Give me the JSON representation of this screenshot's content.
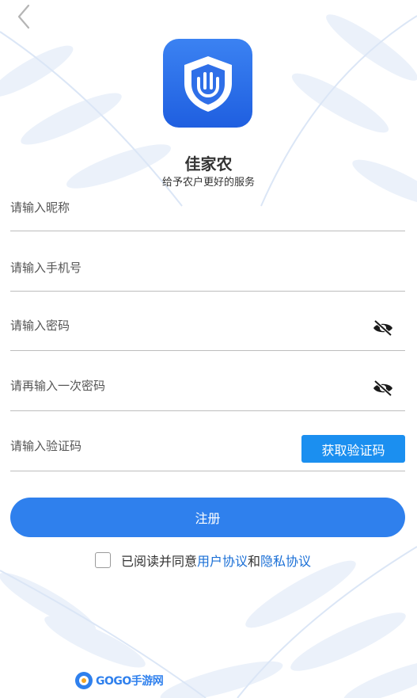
{
  "app": {
    "name": "佳家农",
    "slogan": "给予农户更好的服务"
  },
  "form": {
    "nickname_placeholder": "请输入昵称",
    "phone_placeholder": "请输入手机号",
    "password_placeholder": "请输入密码",
    "confirm_password_placeholder": "请再输入一次密码",
    "code_placeholder": "请输入验证码",
    "get_code_label": "获取验证码"
  },
  "submit_label": "注册",
  "agreement": {
    "prefix": "已阅读并同意",
    "user_agreement": "用户协议",
    "and": "和",
    "privacy_policy": "隐私协议"
  },
  "watermark": {
    "text": "GOGO手游网"
  },
  "colors": {
    "primary": "#2f80ed",
    "code_button": "#1b8ff0",
    "link": "#1a6fd6"
  }
}
